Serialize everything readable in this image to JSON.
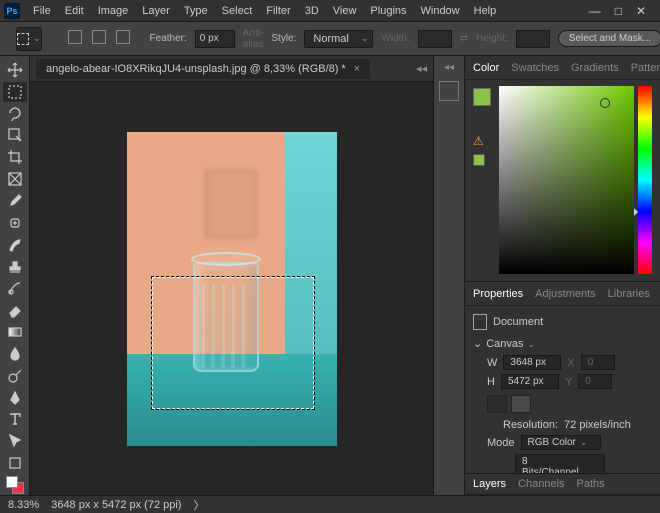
{
  "menu": {
    "items": [
      "File",
      "Edit",
      "Image",
      "Layer",
      "Type",
      "Select",
      "Filter",
      "3D",
      "View",
      "Plugins",
      "Window",
      "Help"
    ]
  },
  "options": {
    "feather_label": "Feather:",
    "feather_value": "0 px",
    "antialias_label": "Anti-alias",
    "style_label": "Style:",
    "style_value": "Normal",
    "width_label": "Width:",
    "height_label": "Height:",
    "mask_button": "Select and Mask..."
  },
  "document": {
    "tab_title": "angelo-abear-IO8XRikqJU4-unsplash.jpg @ 8,33% (RGB/8) *"
  },
  "status": {
    "zoom": "8.33%",
    "dims": "3648 px x 5472 px (72 ppi)"
  },
  "color_panel": {
    "tabs": [
      "Color",
      "Swatches",
      "Gradients",
      "Patterns"
    ]
  },
  "props_panel": {
    "tabs": [
      "Properties",
      "Adjustments",
      "Libraries"
    ],
    "doc_label": "Document",
    "canvas_label": "Canvas",
    "w_label": "W",
    "w_value": "3648 px",
    "x_label": "X",
    "x_value": "0",
    "h_label": "H",
    "h_value": "5472 px",
    "y_label": "Y",
    "y_value": "0",
    "res_label": "Resolution:",
    "res_value": "72 pixels/inch",
    "mode_label": "Mode",
    "mode_value": "RGB Color",
    "bits_value": "8 Bits/Channel"
  },
  "layers_panel": {
    "tabs": [
      "Layers",
      "Channels",
      "Paths"
    ]
  }
}
